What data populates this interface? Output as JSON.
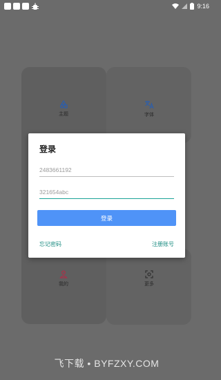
{
  "status_bar": {
    "time": "9:16"
  },
  "tiles": [
    {
      "label": "主题",
      "icon": "theme-icon",
      "color": "#2f5ea8"
    },
    {
      "label": "字体",
      "icon": "translate-icon",
      "color": "#2f5ea8"
    },
    {
      "label": "我的",
      "icon": "person-icon",
      "color": "#a8324a"
    },
    {
      "label": "更多",
      "icon": "more-icon",
      "color": "#333333"
    }
  ],
  "dialog": {
    "title": "登录",
    "account_value": "2483661192",
    "password_value": "321654abc",
    "login_label": "登录",
    "forgot_label": "忘记密码",
    "register_label": "注册账号"
  },
  "watermark": "飞下载 • BYFZXY.COM",
  "colors": {
    "accent_button": "#4f93f7",
    "link": "#1c8c82",
    "focused_underline": "#1aa397",
    "overlay": "#6b6b6b"
  }
}
